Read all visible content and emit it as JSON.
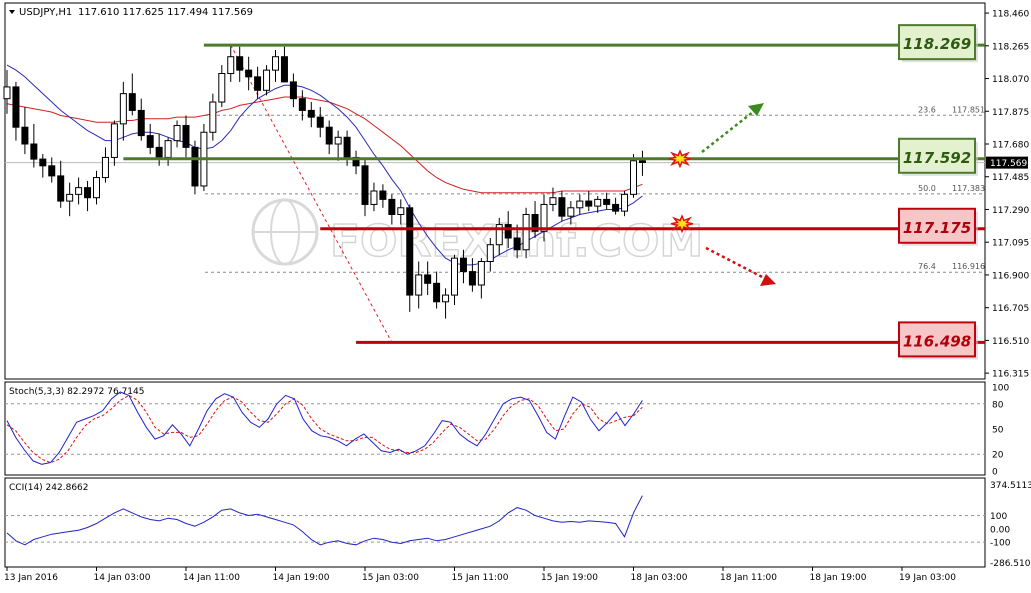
{
  "window": {
    "symbol_title": "USDJPY,H1",
    "ohlc": "117.610 117.625 117.494 117.569",
    "menu_icon": "triangle-down-icon"
  },
  "watermark": {
    "text": "FOREXimf.COM",
    "icon": "globe-logo"
  },
  "colors": {
    "background": "#ffffff",
    "frame": "#000000",
    "bull_candle": "#ffffff",
    "bear_candle": "#000000",
    "ma_fast": "#2b2bb5",
    "ma_slow": "#d42020",
    "support_resistance_green": "#4e7a2e",
    "support_resistance_red": "#c0000f",
    "green_box_fill": "#e3f1cf",
    "red_box_fill": "#f7c7c8",
    "stoch_main": "#2222cc",
    "stoch_signal": "#e01010",
    "cci": "#2222cc",
    "fib_line": "#888888",
    "fib_trend": "#e02020"
  },
  "chart_data": {
    "type": "candlestick",
    "symbol": "USDJPY",
    "timeframe": "H1",
    "price_axis": {
      "ticks": [
        "118.460",
        "118.265",
        "118.070",
        "117.875",
        "117.680",
        "117.485",
        "117.290",
        "117.095",
        "116.900",
        "116.705",
        "116.510",
        "116.315"
      ],
      "range": [
        116.28,
        118.52
      ],
      "current_price_label": "117.569"
    },
    "time_axis": {
      "labels": [
        "13 Jan 2016",
        "14 Jan 03:00",
        "14 Jan 11:00",
        "14 Jan 19:00",
        "15 Jan 03:00",
        "15 Jan 11:00",
        "15 Jan 19:00",
        "18 Jan 03:00",
        "18 Jan 11:00",
        "18 Jan 19:00",
        "19 Jan 03:00"
      ],
      "label_bar_index": [
        0,
        10,
        20,
        30,
        40,
        50,
        60,
        70,
        80,
        90,
        100
      ]
    },
    "candles": [
      [
        117.95,
        118.12,
        117.86,
        118.02
      ],
      [
        118.02,
        118.05,
        117.7,
        117.78
      ],
      [
        117.78,
        117.9,
        117.62,
        117.68
      ],
      [
        117.68,
        117.8,
        117.54,
        117.59
      ],
      [
        117.59,
        117.62,
        117.48,
        117.55
      ],
      [
        117.55,
        117.6,
        117.45,
        117.49
      ],
      [
        117.49,
        117.58,
        117.3,
        117.34
      ],
      [
        117.34,
        117.45,
        117.25,
        117.38
      ],
      [
        117.38,
        117.48,
        117.32,
        117.42
      ],
      [
        117.42,
        117.46,
        117.28,
        117.36
      ],
      [
        117.36,
        117.52,
        117.32,
        117.48
      ],
      [
        117.48,
        117.66,
        117.45,
        117.6
      ],
      [
        117.6,
        117.82,
        117.55,
        117.8
      ],
      [
        117.8,
        118.05,
        117.7,
        117.98
      ],
      [
        117.98,
        118.1,
        117.85,
        117.88
      ],
      [
        117.88,
        117.95,
        117.7,
        117.73
      ],
      [
        117.73,
        117.8,
        117.62,
        117.66
      ],
      [
        117.66,
        117.74,
        117.55,
        117.6
      ],
      [
        117.6,
        117.72,
        117.55,
        117.7
      ],
      [
        117.7,
        117.82,
        117.66,
        117.79
      ],
      [
        117.79,
        117.85,
        117.6,
        117.66
      ],
      [
        117.66,
        117.7,
        117.38,
        117.43
      ],
      [
        117.43,
        117.8,
        117.4,
        117.75
      ],
      [
        117.75,
        117.98,
        117.7,
        117.93
      ],
      [
        117.93,
        118.15,
        117.9,
        118.1
      ],
      [
        118.1,
        118.27,
        118.05,
        118.2
      ],
      [
        118.2,
        118.26,
        118.05,
        118.12
      ],
      [
        118.12,
        118.2,
        118.0,
        118.08
      ],
      [
        118.08,
        118.14,
        117.95,
        118.0
      ],
      [
        118.0,
        118.15,
        117.97,
        118.12
      ],
      [
        118.12,
        118.24,
        118.05,
        118.2
      ],
      [
        118.2,
        118.26,
        118.05,
        118.05
      ],
      [
        118.05,
        118.1,
        117.9,
        117.95
      ],
      [
        117.95,
        118.0,
        117.82,
        117.88
      ],
      [
        117.88,
        117.93,
        117.78,
        117.84
      ],
      [
        117.84,
        117.9,
        117.72,
        117.78
      ],
      [
        117.78,
        117.82,
        117.62,
        117.68
      ],
      [
        117.68,
        117.76,
        117.58,
        117.72
      ],
      [
        117.72,
        117.76,
        117.55,
        117.6
      ],
      [
        117.6,
        117.64,
        117.5,
        117.55
      ],
      [
        117.55,
        117.6,
        117.25,
        117.32
      ],
      [
        117.32,
        117.45,
        117.28,
        117.4
      ],
      [
        117.4,
        117.44,
        117.3,
        117.35
      ],
      [
        117.35,
        117.38,
        117.2,
        117.26
      ],
      [
        117.26,
        117.35,
        117.2,
        117.3
      ],
      [
        117.3,
        117.32,
        116.68,
        116.78
      ],
      [
        116.78,
        116.98,
        116.7,
        116.9
      ],
      [
        116.9,
        116.98,
        116.78,
        116.85
      ],
      [
        116.85,
        116.92,
        116.7,
        116.74
      ],
      [
        116.74,
        116.82,
        116.64,
        116.78
      ],
      [
        116.78,
        117.02,
        116.72,
        117.0
      ],
      [
        117.0,
        117.05,
        116.85,
        116.92
      ],
      [
        116.92,
        117.0,
        116.8,
        116.84
      ],
      [
        116.84,
        117.0,
        116.76,
        116.98
      ],
      [
        116.98,
        117.12,
        116.92,
        117.08
      ],
      [
        117.08,
        117.24,
        117.02,
        117.2
      ],
      [
        117.2,
        117.28,
        117.06,
        117.12
      ],
      [
        117.12,
        117.2,
        117.0,
        117.05
      ],
      [
        117.05,
        117.3,
        117.0,
        117.26
      ],
      [
        117.26,
        117.34,
        117.12,
        117.16
      ],
      [
        117.16,
        117.38,
        117.1,
        117.32
      ],
      [
        117.32,
        117.42,
        117.28,
        117.36
      ],
      [
        117.36,
        117.4,
        117.22,
        117.25
      ],
      [
        117.25,
        117.34,
        117.2,
        117.3
      ],
      [
        117.3,
        117.38,
        117.26,
        117.34
      ],
      [
        117.34,
        117.4,
        117.28,
        117.31
      ],
      [
        117.31,
        117.37,
        117.27,
        117.35
      ],
      [
        117.35,
        117.39,
        117.29,
        117.32
      ],
      [
        117.32,
        117.36,
        117.26,
        117.28
      ],
      [
        117.28,
        117.4,
        117.25,
        117.38
      ],
      [
        117.38,
        117.62,
        117.36,
        117.58
      ],
      [
        117.58,
        117.64,
        117.49,
        117.57
      ]
    ],
    "indicators": {
      "ma_blue": [
        118.15,
        118.12,
        118.08,
        118.03,
        117.98,
        117.93,
        117.88,
        117.84,
        117.8,
        117.76,
        117.73,
        117.7,
        117.7,
        117.72,
        117.74,
        117.75,
        117.75,
        117.74,
        117.72,
        117.7,
        117.69,
        117.66,
        117.65,
        117.66,
        117.7,
        117.76,
        117.84,
        117.9,
        117.95,
        117.98,
        118.01,
        118.03,
        118.03,
        118.02,
        118.0,
        117.97,
        117.93,
        117.89,
        117.84,
        117.78,
        117.7,
        117.62,
        117.55,
        117.47,
        117.4,
        117.3,
        117.21,
        117.13,
        117.06,
        117.0,
        116.97,
        116.96,
        116.96,
        116.97,
        116.99,
        117.02,
        117.05,
        117.07,
        117.1,
        117.13,
        117.16,
        117.19,
        117.22,
        117.24,
        117.26,
        117.27,
        117.28,
        117.29,
        117.29,
        117.3,
        117.33,
        117.37
      ],
      "ma_red": [
        117.92,
        117.91,
        117.9,
        117.89,
        117.88,
        117.87,
        117.85,
        117.84,
        117.83,
        117.82,
        117.81,
        117.81,
        117.81,
        117.82,
        117.82,
        117.83,
        117.83,
        117.83,
        117.83,
        117.84,
        117.84,
        117.84,
        117.85,
        117.86,
        117.88,
        117.89,
        117.91,
        117.92,
        117.93,
        117.94,
        117.95,
        117.96,
        117.96,
        117.96,
        117.95,
        117.94,
        117.93,
        117.91,
        117.89,
        117.86,
        117.83,
        117.79,
        117.75,
        117.71,
        117.67,
        117.62,
        117.57,
        117.52,
        117.48,
        117.45,
        117.43,
        117.41,
        117.4,
        117.39,
        117.39,
        117.39,
        117.39,
        117.39,
        117.39,
        117.39,
        117.39,
        117.39,
        117.4,
        117.4,
        117.4,
        117.4,
        117.4,
        117.4,
        117.4,
        117.4,
        117.42,
        117.44
      ]
    },
    "levels": [
      {
        "price": "118.269",
        "kind": "resistance",
        "color": "green"
      },
      {
        "price": "117.592",
        "kind": "resistance",
        "color": "green"
      },
      {
        "price": "117.175",
        "kind": "support",
        "color": "red"
      },
      {
        "price": "116.498",
        "kind": "support",
        "color": "red"
      }
    ],
    "fibonacci": [
      {
        "level": "23.6",
        "price": "117.851"
      },
      {
        "level": "50.0",
        "price": "117.383"
      },
      {
        "level": "76.4",
        "price": "116.916"
      }
    ],
    "stochastic": {
      "label": "Stoch(5,3,3) 82.2972 76.7145",
      "axis_ticks": [
        "100",
        "80",
        "50",
        "20",
        "0"
      ],
      "main": [
        60,
        40,
        25,
        12,
        8,
        10,
        22,
        40,
        58,
        62,
        66,
        72,
        86,
        94,
        90,
        70,
        52,
        38,
        42,
        55,
        44,
        30,
        50,
        72,
        86,
        92,
        88,
        70,
        58,
        52,
        62,
        80,
        90,
        86,
        62,
        48,
        42,
        40,
        36,
        30,
        38,
        44,
        34,
        24,
        22,
        26,
        20,
        24,
        30,
        44,
        60,
        58,
        44,
        36,
        30,
        44,
        62,
        80,
        86,
        88,
        84,
        66,
        46,
        38,
        64,
        88,
        82,
        62,
        48,
        58,
        70,
        54,
        68,
        84
      ],
      "signal": [
        55,
        48,
        34,
        22,
        14,
        10,
        14,
        24,
        40,
        54,
        62,
        66,
        74,
        84,
        90,
        84,
        70,
        52,
        44,
        46,
        46,
        40,
        42,
        56,
        72,
        84,
        88,
        82,
        70,
        60,
        58,
        68,
        80,
        86,
        78,
        62,
        50,
        44,
        40,
        36,
        36,
        40,
        40,
        32,
        26,
        24,
        22,
        22,
        26,
        34,
        46,
        56,
        52,
        44,
        36,
        38,
        50,
        66,
        78,
        84,
        86,
        78,
        62,
        48,
        50,
        68,
        80,
        76,
        62,
        56,
        60,
        64,
        66,
        76
      ]
    },
    "cci": {
      "label": "CCI(14) 242.8662",
      "axis_ticks": [
        "374.5113",
        "100",
        "0.00",
        "-100",
        "-286.5107"
      ],
      "values": [
        -30,
        -90,
        -120,
        -80,
        -60,
        -40,
        -30,
        -20,
        -10,
        10,
        40,
        80,
        120,
        150,
        120,
        90,
        70,
        60,
        80,
        70,
        40,
        20,
        50,
        90,
        140,
        150,
        120,
        100,
        110,
        90,
        70,
        50,
        30,
        -20,
        -80,
        -120,
        -100,
        -90,
        -110,
        -120,
        -90,
        -70,
        -80,
        -100,
        -110,
        -90,
        -80,
        -70,
        -90,
        -80,
        -60,
        -40,
        -20,
        0,
        20,
        60,
        120,
        160,
        140,
        100,
        80,
        60,
        50,
        55,
        50,
        60,
        55,
        50,
        40,
        -60,
        120,
        250
      ]
    }
  }
}
